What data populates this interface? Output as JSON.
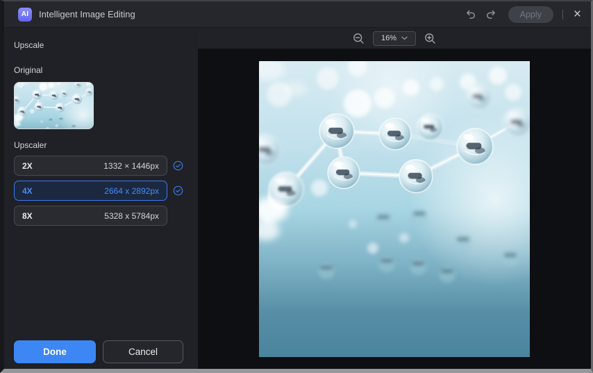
{
  "window": {
    "logo_text": "AI",
    "title": "Intelligent Image Editing",
    "apply_label": "Apply",
    "close_glyph": "×"
  },
  "panel": {
    "section_title": "Upscale",
    "original_label": "Original",
    "upscaler_label": "Upscaler",
    "options": [
      {
        "label": "2X",
        "dimensions": "1332 × 1446px",
        "checked": true,
        "selected": false
      },
      {
        "label": "4X",
        "dimensions": "2664 x 2892px",
        "checked": true,
        "selected": true
      },
      {
        "label": "8X",
        "dimensions": "5328 x 5784px",
        "checked": false,
        "selected": false
      }
    ],
    "done_label": "Done",
    "cancel_label": "Cancel"
  },
  "preview": {
    "zoom_value": "16%"
  },
  "icons": {
    "titlebar": [
      "undo-icon",
      "redo-icon",
      "close-icon"
    ],
    "toolbar": [
      "zoom-out-icon",
      "zoom-in-icon",
      "chevron-down-icon"
    ],
    "options": [
      "check-circle-icon"
    ]
  },
  "colors": {
    "accent_blue": "#3a7bf2",
    "selected_row_bg": "#1b2840",
    "done_button_bg": "#3d87f5",
    "titlebar_bg": "#26272c",
    "panel_bg": "#1f2126",
    "canvas_bg": "#0e0f12"
  }
}
